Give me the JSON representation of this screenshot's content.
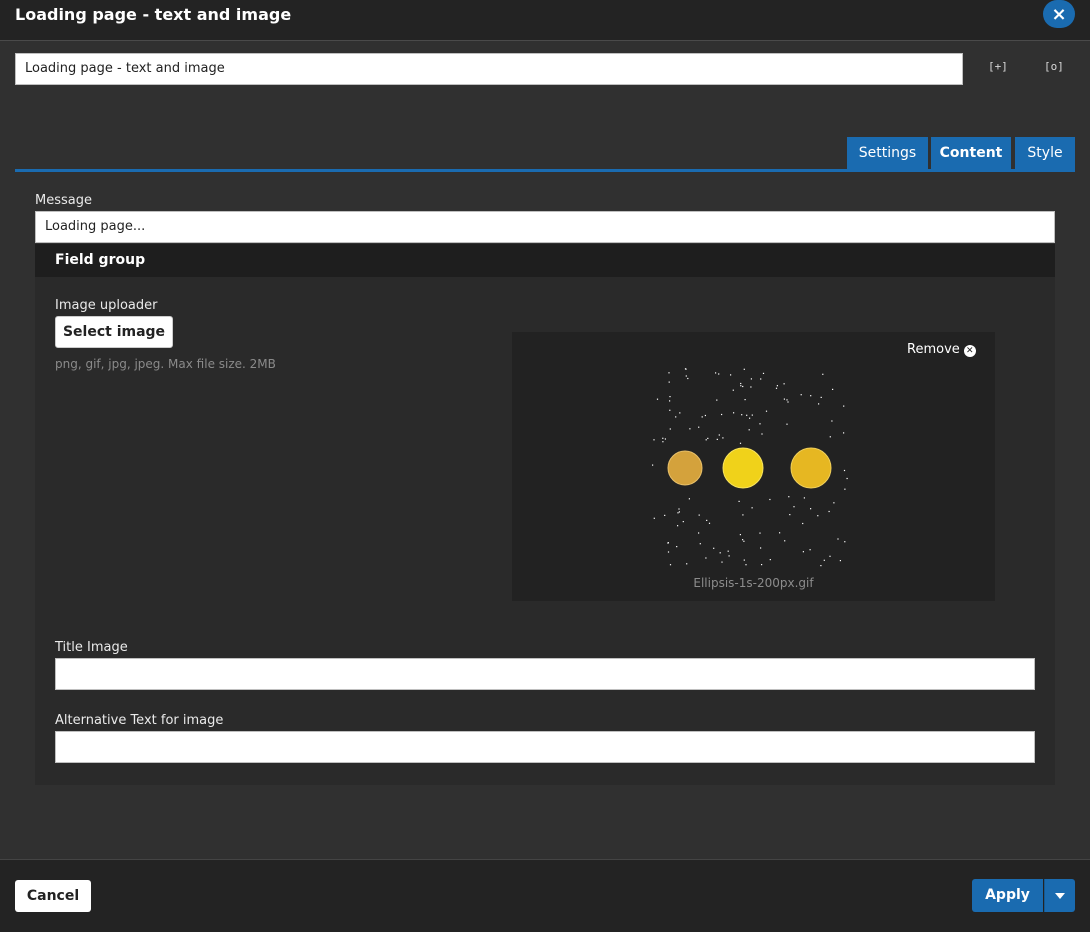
{
  "header": {
    "title": "Loading page - text and image"
  },
  "name_field": {
    "value": "Loading page - text and image"
  },
  "icons": {
    "expand": "[+]",
    "preview": "[o]",
    "close": "×"
  },
  "tabs": [
    {
      "label": "Settings",
      "active": false
    },
    {
      "label": "Content",
      "active": true
    },
    {
      "label": "Style",
      "active": false
    }
  ],
  "message": {
    "label": "Message",
    "value": "Loading page..."
  },
  "field_group": {
    "title": "Field group",
    "image_uploader": {
      "label": "Image uploader",
      "select_label": "Select image",
      "hint": "png, gif, jpg, jpeg. Max file size. 2MB",
      "remove_label": "Remove",
      "file_name": "Ellipsis-1s-200px.gif",
      "dot_colors": [
        "#d4a23c",
        "#f0d21a",
        "#e6b722"
      ]
    },
    "title_image": {
      "label": "Title Image",
      "value": ""
    },
    "alt_text": {
      "label": "Alternative Text for image",
      "value": ""
    }
  },
  "footer": {
    "cancel_label": "Cancel",
    "apply_label": "Apply"
  },
  "colors": {
    "accent": "#1a6bb0",
    "background": "#303030"
  }
}
